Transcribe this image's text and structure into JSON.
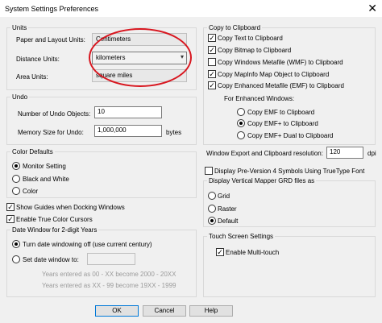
{
  "window": {
    "title": "System Settings Preferences",
    "close_glyph": "✕"
  },
  "units": {
    "legend": "Units",
    "paper_label": "Paper and Layout Units:",
    "paper_value": "Centimeters",
    "distance_label": "Distance Units:",
    "distance_value": "kilometers",
    "area_label": "Area Units:",
    "area_value": "square miles"
  },
  "undo": {
    "legend": "Undo",
    "objects_label": "Number of Undo Objects:",
    "objects_value": "10",
    "memory_label": "Memory Size for Undo:",
    "memory_value": "1,000,000",
    "memory_unit": "bytes"
  },
  "color_defaults": {
    "legend": "Color Defaults",
    "options": [
      "Monitor Setting",
      "Black and White",
      "Color"
    ],
    "selected": 0
  },
  "checks_left": {
    "guides": "Show Guides when Docking Windows",
    "true_color": "Enable True Color Cursors"
  },
  "date_window": {
    "legend": "Date Window for 2-digit Years",
    "turn_off": "Turn date windowing off (use current century)",
    "set_to": "Set date window to:",
    "note1": "Years entered as 00 - XX become 2000 - 20XX",
    "note2": "Years entered as XX - 99 become 19XX - 1999"
  },
  "clipboard": {
    "legend": "Copy to Clipboard",
    "items": [
      "Copy Text to Clipboard",
      "Copy Bitmap to Clipboard",
      "Copy Windows Metafile (WMF) to Clipboard",
      "Copy MapInfo Map Object to Clipboard",
      "Copy Enhanced Metafile (EMF) to Clipboard"
    ],
    "checked": [
      true,
      true,
      false,
      true,
      true
    ],
    "for_enhanced": "For Enhanced Windows:",
    "emf_options": [
      "Copy EMF to Clipboard",
      "Copy EMF+ to Clipboard",
      "Copy EMF+ Dual to Clipboard"
    ],
    "emf_selected": 1
  },
  "export": {
    "resolution_label": "Window Export and Clipboard resolution:",
    "resolution_value": "120",
    "resolution_unit": "dpi",
    "prev4_label": "Display Pre-Version 4 Symbols Using TrueType Font"
  },
  "grd": {
    "legend": "Display Vertical Mapper GRD files as",
    "options": [
      "Grid",
      "Raster",
      "Default"
    ],
    "selected": 2
  },
  "touch": {
    "legend": "Touch Screen Settings",
    "multitouch": "Enable Multi-touch"
  },
  "buttons": {
    "ok": "OK",
    "cancel": "Cancel",
    "help": "Help"
  },
  "highlight": {
    "ellipse_color": "#d8161f"
  }
}
